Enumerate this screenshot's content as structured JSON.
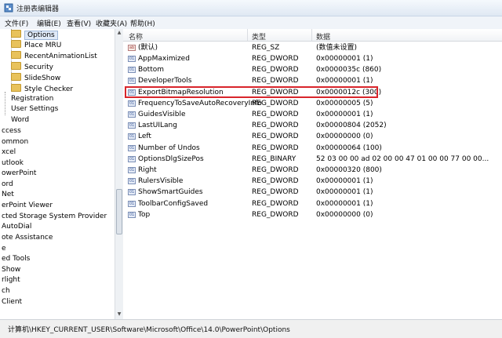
{
  "window": {
    "title": "注册表编辑器"
  },
  "menu": [
    "文件(F)",
    "编辑(E)",
    "查看(V)",
    "收藏夹(A)",
    "帮助(H)"
  ],
  "tree": [
    {
      "label": "Options",
      "folder": true,
      "selected": true
    },
    {
      "label": "Place MRU",
      "folder": true
    },
    {
      "label": "RecentAnimationList",
      "folder": true
    },
    {
      "label": "Security",
      "folder": true
    },
    {
      "label": "SlideShow",
      "folder": true
    },
    {
      "label": "Style Checker",
      "folder": true
    },
    {
      "label": "Registration"
    },
    {
      "label": "User Settings"
    },
    {
      "label": "Word"
    },
    {
      "label": "ccess"
    },
    {
      "label": "ommon"
    },
    {
      "label": "xcel"
    },
    {
      "label": "utlook"
    },
    {
      "label": "owerPoint"
    },
    {
      "label": "ord"
    },
    {
      "label": "Net"
    },
    {
      "label": "erPoint Viewer"
    },
    {
      "label": "cted Storage System Provider"
    },
    {
      "label": "AutoDial"
    },
    {
      "label": "ote Assistance"
    },
    {
      "label": "e"
    },
    {
      "label": "ed Tools"
    },
    {
      "label": "Show"
    },
    {
      "label": "rlight"
    },
    {
      "label": "ch"
    },
    {
      "label": "Client"
    }
  ],
  "columns": {
    "name": "名称",
    "type": "类型",
    "data": "数据"
  },
  "values": [
    {
      "name": "(默认)",
      "type": "REG_SZ",
      "data": "(数值未设置)",
      "icon": "ab"
    },
    {
      "name": "AppMaximized",
      "type": "REG_DWORD",
      "data": "0x00000001 (1)",
      "icon": "bin"
    },
    {
      "name": "Bottom",
      "type": "REG_DWORD",
      "data": "0x0000035c (860)",
      "icon": "bin"
    },
    {
      "name": "DeveloperTools",
      "type": "REG_DWORD",
      "data": "0x00000001 (1)",
      "icon": "bin"
    },
    {
      "name": "ExportBitmapResolution",
      "type": "REG_DWORD",
      "data": "0x0000012c (300)",
      "icon": "bin",
      "highlighted": true
    },
    {
      "name": "FrequencyToSaveAutoRecoveryInfo",
      "type": "REG_DWORD",
      "data": "0x00000005 (5)",
      "icon": "bin"
    },
    {
      "name": "GuidesVisible",
      "type": "REG_DWORD",
      "data": "0x00000001 (1)",
      "icon": "bin"
    },
    {
      "name": "LastUILang",
      "type": "REG_DWORD",
      "data": "0x00000804 (2052)",
      "icon": "bin"
    },
    {
      "name": "Left",
      "type": "REG_DWORD",
      "data": "0x00000000 (0)",
      "icon": "bin"
    },
    {
      "name": "Number of Undos",
      "type": "REG_DWORD",
      "data": "0x00000064 (100)",
      "icon": "bin"
    },
    {
      "name": "OptionsDlgSizePos",
      "type": "REG_BINARY",
      "data": "52 03 00 00 ad 02 00 00 47 01 00 00 77 00 00...",
      "icon": "bin"
    },
    {
      "name": "Right",
      "type": "REG_DWORD",
      "data": "0x00000320 (800)",
      "icon": "bin"
    },
    {
      "name": "RulersVisible",
      "type": "REG_DWORD",
      "data": "0x00000001 (1)",
      "icon": "bin"
    },
    {
      "name": "ShowSmartGuides",
      "type": "REG_DWORD",
      "data": "0x00000001 (1)",
      "icon": "bin"
    },
    {
      "name": "ToolbarConfigSaved",
      "type": "REG_DWORD",
      "data": "0x00000001 (1)",
      "icon": "bin"
    },
    {
      "name": "Top",
      "type": "REG_DWORD",
      "data": "0x00000000 (0)",
      "icon": "bin"
    }
  ],
  "status": {
    "path": "计算机\\HKEY_CURRENT_USER\\Software\\Microsoft\\Office\\14.0\\PowerPoint\\Options"
  },
  "icons": {
    "app": "regedit-icon",
    "folder": "folder-icon",
    "value": "registry-value-icon"
  },
  "colors": {
    "highlight_box": "#d8252b",
    "selection": "#dfe9f7"
  }
}
